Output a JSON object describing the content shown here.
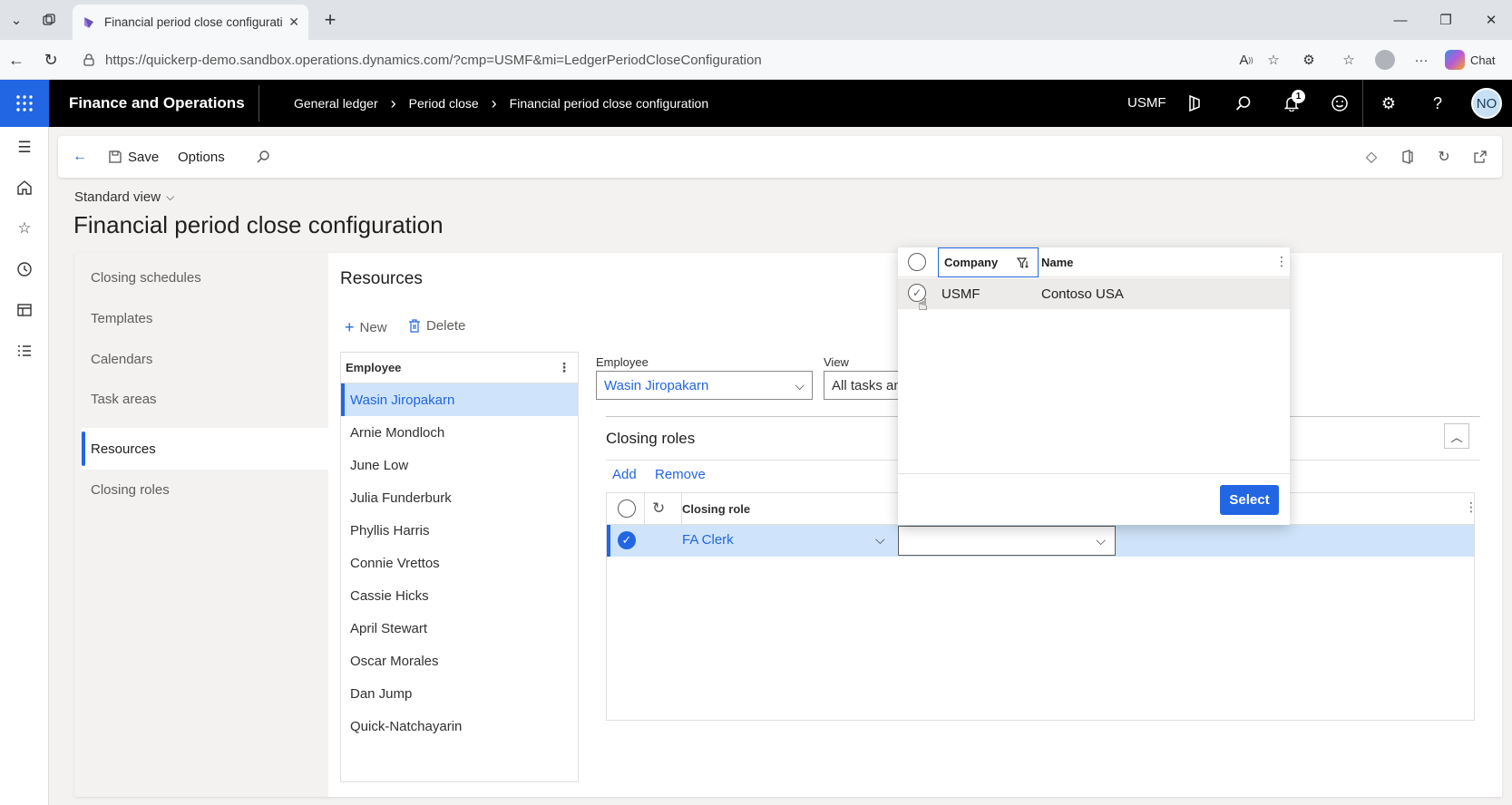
{
  "browser": {
    "tab_title": "Financial period close configuratio",
    "url": "https://quickerp-demo.sandbox.operations.dynamics.com/?cmp=USMF&mi=LedgerPeriodCloseConfiguration",
    "chat_label": "Chat"
  },
  "appbar": {
    "title": "Finance and Operations",
    "breadcrumbs": [
      "General ledger",
      "Period close",
      "Financial period close configuration"
    ],
    "company": "USMF",
    "notification_count": "1",
    "user_initials": "NO"
  },
  "actionpane": {
    "save_label": "Save",
    "options_label": "Options"
  },
  "page": {
    "view_selector": "Standard view",
    "title": "Financial period close configuration"
  },
  "vertical_tabs": [
    "Closing schedules",
    "Templates",
    "Calendars",
    "Task areas",
    "Resources",
    "Closing roles"
  ],
  "resources": {
    "title": "Resources",
    "new_label": "New",
    "delete_label": "Delete",
    "employee_column": "Employee",
    "employees": [
      "Wasin Jiropakarn",
      "Arnie Mondloch",
      "June Low",
      "Julia Funderburk",
      "Phyllis Harris",
      "Connie Vrettos",
      "Cassie Hicks",
      "April Stewart",
      "Oscar Morales",
      "Dan Jump",
      "Quick-Natchayarin"
    ]
  },
  "filters": {
    "employee_label": "Employee",
    "employee_value": "Wasin Jiropakarn",
    "view_label": "View",
    "view_value": "All tasks an"
  },
  "closing_roles": {
    "title": "Closing roles",
    "add_label": "Add",
    "remove_label": "Remove",
    "column_role": "Closing role",
    "row_role": "FA Clerk"
  },
  "lookup": {
    "col_company": "Company",
    "col_name": "Name",
    "row_company": "USMF",
    "row_name": "Contoso USA",
    "select_label": "Select"
  },
  "colors": {
    "accent": "#2266e3",
    "appbar": "#000000",
    "selected_row": "#cfe4fa"
  }
}
